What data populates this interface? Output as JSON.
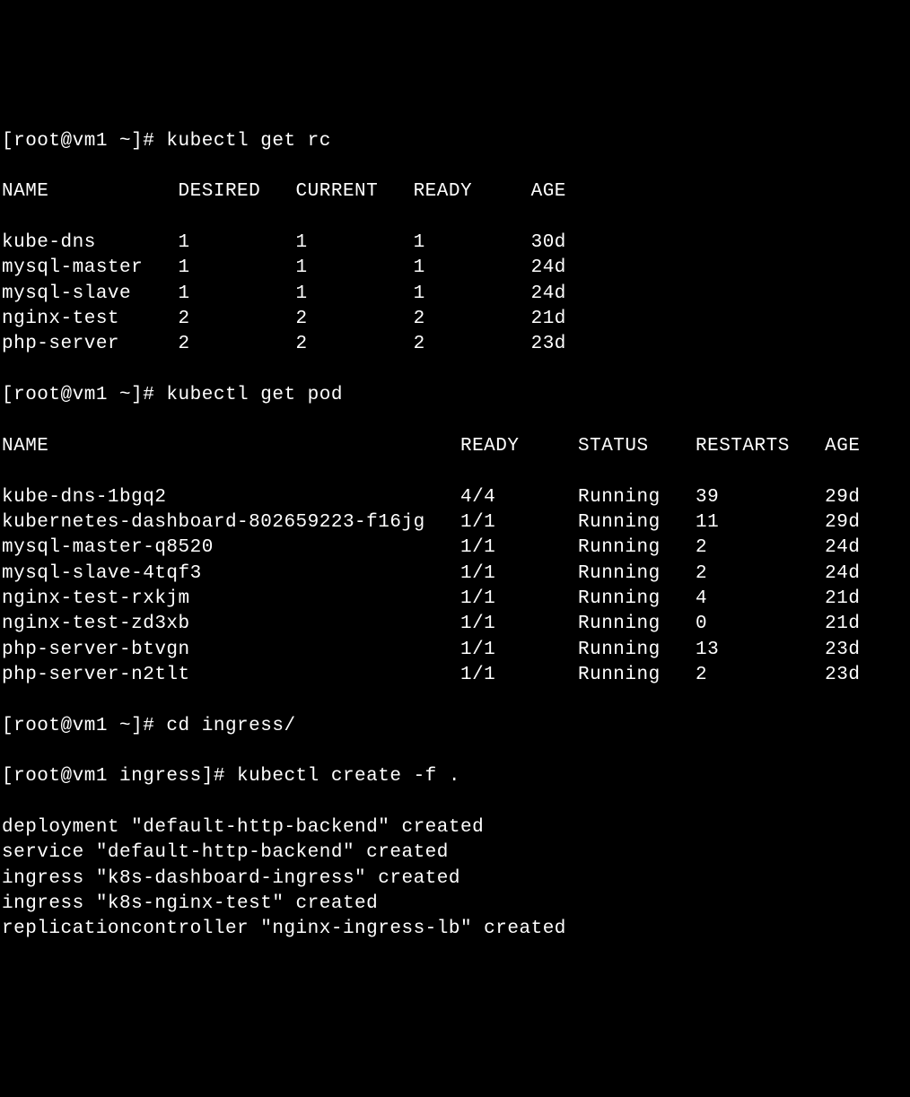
{
  "prompt1": "[root@vm1 ~]# kubectl get rc",
  "rc_header": {
    "name": "NAME",
    "desired": "DESIRED",
    "current": "CURRENT",
    "ready": "READY",
    "age": "AGE"
  },
  "rc_rows": [
    {
      "name": "kube-dns",
      "desired": "1",
      "current": "1",
      "ready": "1",
      "age": "30d"
    },
    {
      "name": "mysql-master",
      "desired": "1",
      "current": "1",
      "ready": "1",
      "age": "24d"
    },
    {
      "name": "mysql-slave",
      "desired": "1",
      "current": "1",
      "ready": "1",
      "age": "24d"
    },
    {
      "name": "nginx-test",
      "desired": "2",
      "current": "2",
      "ready": "2",
      "age": "21d"
    },
    {
      "name": "php-server",
      "desired": "2",
      "current": "2",
      "ready": "2",
      "age": "23d"
    }
  ],
  "prompt2": "[root@vm1 ~]# kubectl get pod",
  "pod_header": {
    "name": "NAME",
    "ready": "READY",
    "status": "STATUS",
    "restarts": "RESTARTS",
    "age": "AGE"
  },
  "pod_rows": [
    {
      "name": "kube-dns-1bgq2",
      "ready": "4/4",
      "status": "Running",
      "restarts": "39",
      "age": "29d"
    },
    {
      "name": "kubernetes-dashboard-802659223-f16jg",
      "ready": "1/1",
      "status": "Running",
      "restarts": "11",
      "age": "29d"
    },
    {
      "name": "mysql-master-q8520",
      "ready": "1/1",
      "status": "Running",
      "restarts": "2",
      "age": "24d"
    },
    {
      "name": "mysql-slave-4tqf3",
      "ready": "1/1",
      "status": "Running",
      "restarts": "2",
      "age": "24d"
    },
    {
      "name": "nginx-test-rxkjm",
      "ready": "1/1",
      "status": "Running",
      "restarts": "4",
      "age": "21d"
    },
    {
      "name": "nginx-test-zd3xb",
      "ready": "1/1",
      "status": "Running",
      "restarts": "0",
      "age": "21d"
    },
    {
      "name": "php-server-btvgn",
      "ready": "1/1",
      "status": "Running",
      "restarts": "13",
      "age": "23d"
    },
    {
      "name": "php-server-n2tlt",
      "ready": "1/1",
      "status": "Running",
      "restarts": "2",
      "age": "23d"
    }
  ],
  "prompt3": "[root@vm1 ~]# cd ingress/",
  "prompt4": "[root@vm1 ingress]# kubectl create -f .",
  "output_lines": [
    "deployment \"default-http-backend\" created",
    "service \"default-http-backend\" created",
    "ingress \"k8s-dashboard-ingress\" created",
    "ingress \"k8s-nginx-test\" created",
    "replicationcontroller \"nginx-ingress-lb\" created"
  ]
}
